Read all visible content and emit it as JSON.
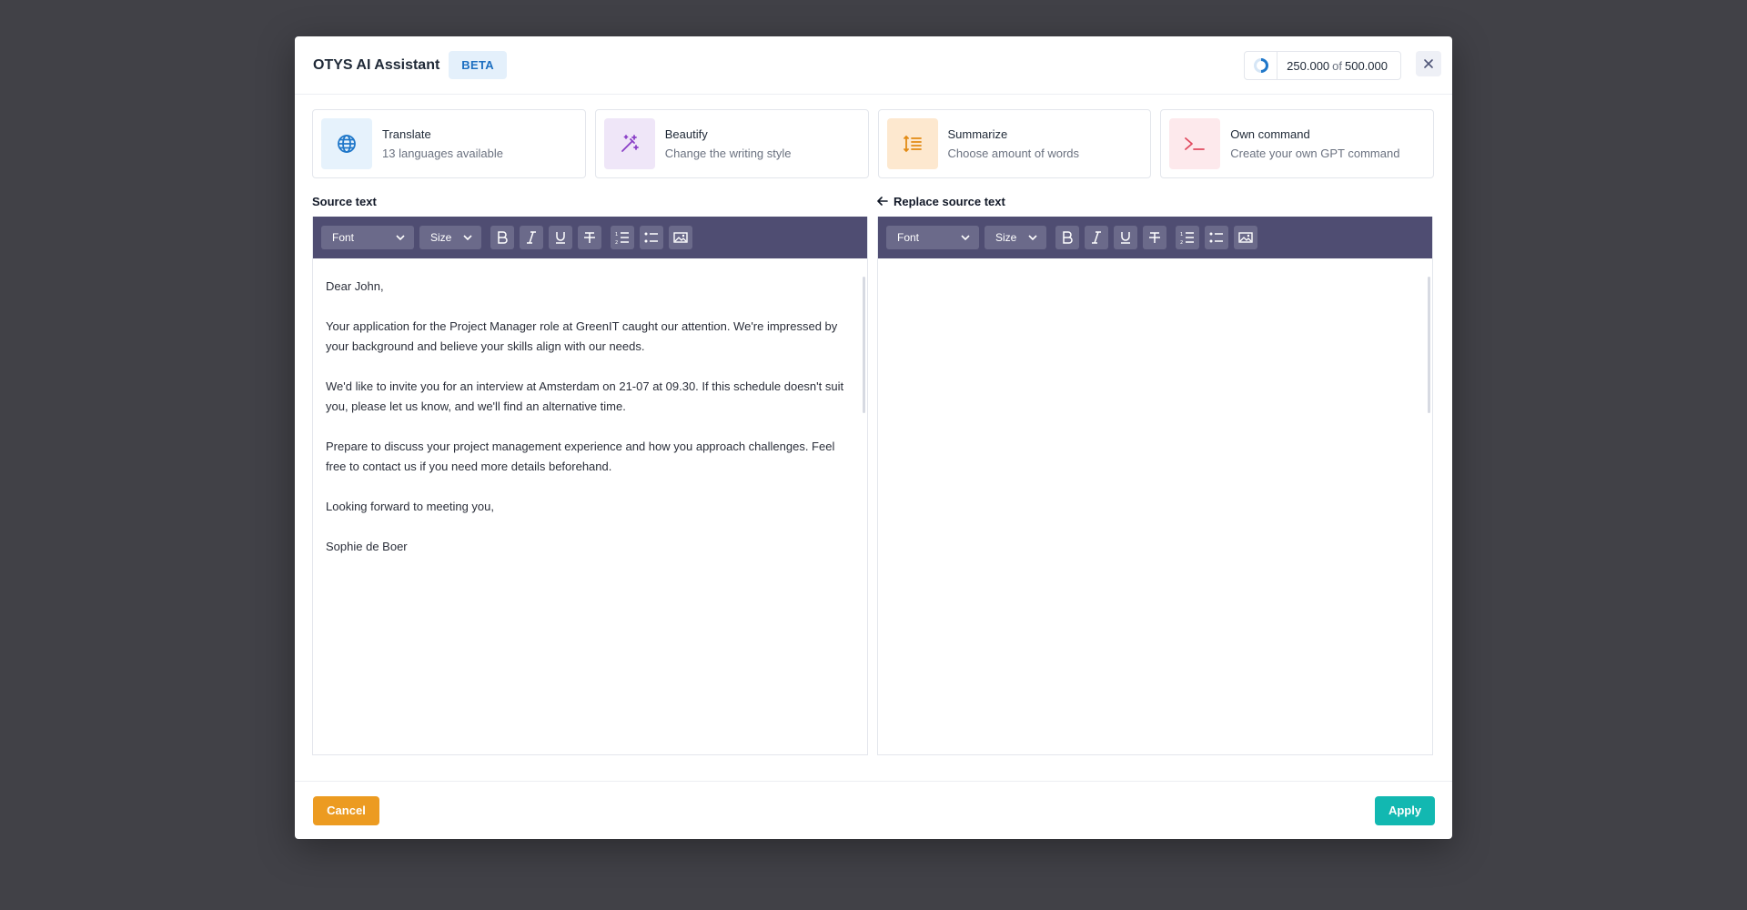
{
  "header": {
    "title": "OTYS AI Assistant",
    "badge": "BETA",
    "credits_used": "250.000",
    "credits_of": "of",
    "credits_total": "500.000"
  },
  "actions": [
    {
      "title": "Translate",
      "subtitle": "13 languages available",
      "icon": "globe-icon",
      "bg": "#e6f2fc",
      "color": "#1f77c9"
    },
    {
      "title": "Beautify",
      "subtitle": "Change the writing style",
      "icon": "magic-wand-icon",
      "bg": "#efe6f8",
      "color": "#8a3fc7"
    },
    {
      "title": "Summarize",
      "subtitle": "Choose amount of words",
      "icon": "summarize-icon",
      "bg": "#fde8cf",
      "color": "#e28a14"
    },
    {
      "title": "Own command",
      "subtitle": "Create your own GPT command",
      "icon": "terminal-icon",
      "bg": "#fde9ec",
      "color": "#e04a5f"
    }
  ],
  "source": {
    "label": "Source text",
    "toolbar": {
      "font": "Font",
      "size": "Size"
    },
    "paragraphs": [
      "Dear John,",
      "Your application for the Project Manager role at GreenIT caught our attention. We're impressed by your background and believe your skills align with our needs.",
      "We'd like to invite you for an interview at Amsterdam on 21-07 at 09.30. If this schedule doesn't suit you, please let us know, and we'll find an alternative time.",
      "Prepare to discuss your project management experience and how you approach challenges. Feel free to contact us if you need more details beforehand.",
      "Looking forward to meeting you,",
      "Sophie de Boer"
    ]
  },
  "target": {
    "label": "Replace source text",
    "toolbar": {
      "font": "Font",
      "size": "Size"
    }
  },
  "footer": {
    "cancel": "Cancel",
    "apply": "Apply"
  },
  "colors": {
    "toolbar": "#4f4d72",
    "cancel": "#ec9b21",
    "apply": "#12b8b1"
  }
}
